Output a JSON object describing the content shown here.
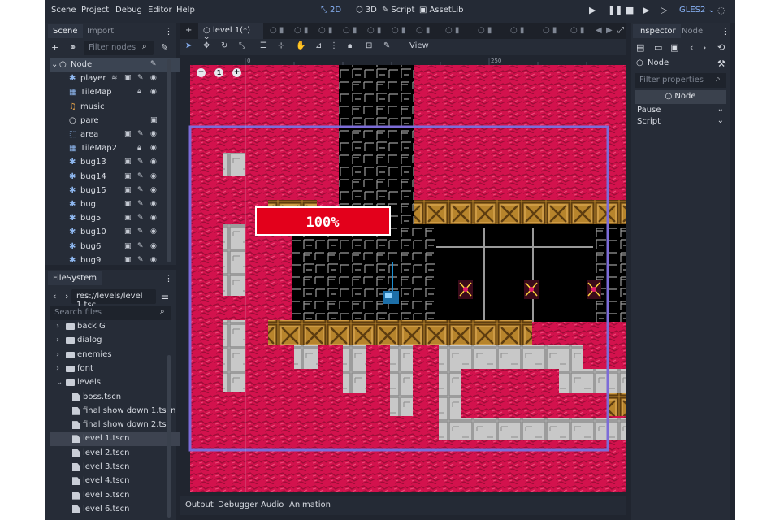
{
  "menubar": {
    "menus": [
      "Scene",
      "Project",
      "Debug",
      "Editor",
      "Help"
    ],
    "workspaces": [
      {
        "icon": "2d-icon",
        "label": "2D",
        "active": true
      },
      {
        "icon": "3d-icon",
        "label": "3D",
        "active": false
      },
      {
        "icon": "script-icon",
        "label": "Script",
        "active": false
      },
      {
        "icon": "assetlib-icon",
        "label": "AssetLib",
        "active": false
      }
    ],
    "renderer": "GLES2"
  },
  "scene_dock": {
    "tabs": [
      "Scene",
      "Import"
    ],
    "filter_placeholder": "Filter nodes",
    "nodes": [
      {
        "label": "Node",
        "icon": "node-icon",
        "indent": 0,
        "selected": true,
        "badges": [
          "script"
        ]
      },
      {
        "label": "player",
        "icon": "character-icon",
        "indent": 1,
        "badges": [
          "signal",
          "group",
          "script",
          "eye"
        ]
      },
      {
        "label": "TileMap",
        "icon": "tilemap-icon",
        "indent": 1,
        "badges": [
          "lock",
          "eye"
        ]
      },
      {
        "label": "music",
        "icon": "audio-icon",
        "indent": 1,
        "badges": []
      },
      {
        "label": "pare",
        "icon": "node-icon",
        "indent": 1,
        "badges": [
          "group"
        ]
      },
      {
        "label": "area",
        "icon": "area-icon",
        "indent": 1,
        "badges": [
          "group",
          "script",
          "eye"
        ]
      },
      {
        "label": "TileMap2",
        "icon": "tilemap-icon",
        "indent": 1,
        "badges": [
          "lock",
          "eye"
        ]
      },
      {
        "label": "bug13",
        "icon": "character-icon",
        "indent": 1,
        "badges": [
          "group",
          "script",
          "eye"
        ]
      },
      {
        "label": "bug14",
        "icon": "character-icon",
        "indent": 1,
        "badges": [
          "group",
          "script",
          "eye"
        ]
      },
      {
        "label": "bug15",
        "icon": "character-icon",
        "indent": 1,
        "badges": [
          "group",
          "script",
          "eye"
        ]
      },
      {
        "label": "bug",
        "icon": "character-icon",
        "indent": 1,
        "badges": [
          "group",
          "script",
          "eye"
        ]
      },
      {
        "label": "bug5",
        "icon": "character-icon",
        "indent": 1,
        "badges": [
          "group",
          "script",
          "eye"
        ]
      },
      {
        "label": "bug10",
        "icon": "character-icon",
        "indent": 1,
        "badges": [
          "group",
          "script",
          "eye"
        ]
      },
      {
        "label": "bug6",
        "icon": "character-icon",
        "indent": 1,
        "badges": [
          "group",
          "script",
          "eye"
        ]
      },
      {
        "label": "bug9",
        "icon": "character-icon",
        "indent": 1,
        "badges": [
          "group",
          "script",
          "eye"
        ]
      }
    ]
  },
  "filesystem": {
    "tab": "FileSystem",
    "path": "res://levels/level 1.tsc",
    "search_placeholder": "Search files",
    "items": [
      {
        "label": "back G",
        "type": "folder",
        "indent": 1,
        "expanded": false
      },
      {
        "label": "dialog",
        "type": "folder",
        "indent": 1,
        "expanded": false
      },
      {
        "label": "enemies",
        "type": "folder",
        "indent": 1,
        "expanded": false
      },
      {
        "label": "font",
        "type": "folder",
        "indent": 1,
        "expanded": false
      },
      {
        "label": "levels",
        "type": "folder",
        "indent": 1,
        "expanded": true
      },
      {
        "label": "boss.tscn",
        "type": "file",
        "indent": 2
      },
      {
        "label": "final show down 1.tscn",
        "type": "file",
        "indent": 2
      },
      {
        "label": "final show down 2.tsc",
        "type": "file",
        "indent": 2
      },
      {
        "label": "level 1.tscn",
        "type": "file",
        "indent": 2,
        "selected": true
      },
      {
        "label": "level 2.tscn",
        "type": "file",
        "indent": 2
      },
      {
        "label": "level 3.tscn",
        "type": "file",
        "indent": 2
      },
      {
        "label": "level 4.tscn",
        "type": "file",
        "indent": 2
      },
      {
        "label": "level 5.tscn",
        "type": "file",
        "indent": 2
      },
      {
        "label": "level 6.tscn",
        "type": "file",
        "indent": 2
      }
    ]
  },
  "scene_tabs": {
    "active": "level 1(*)",
    "close_glyph": "×"
  },
  "toolbar": {
    "view_label": "View"
  },
  "viewport": {
    "ruler_labels": [
      "0",
      "250"
    ],
    "ruler_left_label": "0",
    "zoom_buttons": [
      "−",
      "1",
      "+"
    ],
    "hud_text": "100%",
    "colors": {
      "lava": "#d3124d",
      "lava_dark": "#9c0e38",
      "bg": "#000000",
      "crate": "#b7842c",
      "block": "#c8c8c8",
      "frame": "#7c6cd8",
      "hud": "#e3001b"
    }
  },
  "bottom_panel": {
    "tabs": [
      "Output",
      "Debugger",
      "Audio",
      "Animation"
    ]
  },
  "inspector": {
    "tabs": [
      "Inspector",
      "Node"
    ],
    "node_label": "Node",
    "filter_placeholder": "Filter properties",
    "section": "Node",
    "properties": [
      "Pause",
      "Script"
    ]
  }
}
